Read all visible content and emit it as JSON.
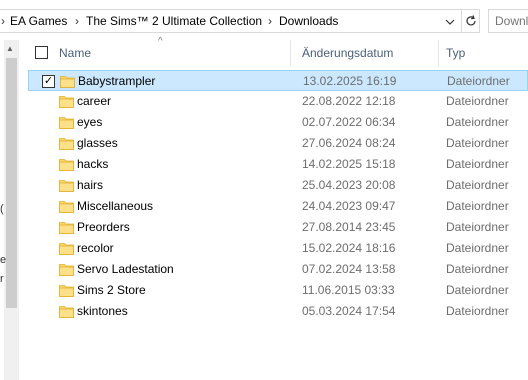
{
  "address": {
    "breadcrumbs": [
      "EA Games",
      "The Sims™ 2 Ultimate Collection",
      "Downloads"
    ],
    "separator": "›"
  },
  "search": {
    "placeholder": "Downloads durchsuchen"
  },
  "columns": {
    "name": "Name",
    "date": "Änderungsdatum",
    "type": "Typ"
  },
  "nav_fragments": [
    "(",
    "e",
    "r"
  ],
  "files": [
    {
      "name": "Babystrampler",
      "date": "13.02.2025 16:19",
      "type": "Dateiordner",
      "selected": true
    },
    {
      "name": "career",
      "date": "22.08.2022 12:18",
      "type": "Dateiordner",
      "selected": false
    },
    {
      "name": "eyes",
      "date": "02.07.2022 06:34",
      "type": "Dateiordner",
      "selected": false
    },
    {
      "name": "glasses",
      "date": "27.06.2024 08:24",
      "type": "Dateiordner",
      "selected": false
    },
    {
      "name": "hacks",
      "date": "14.02.2025 15:18",
      "type": "Dateiordner",
      "selected": false
    },
    {
      "name": "hairs",
      "date": "25.04.2023 20:08",
      "type": "Dateiordner",
      "selected": false
    },
    {
      "name": "Miscellaneous",
      "date": "24.04.2023 09:47",
      "type": "Dateiordner",
      "selected": false
    },
    {
      "name": "Preorders",
      "date": "27.08.2014 23:45",
      "type": "Dateiordner",
      "selected": false
    },
    {
      "name": "recolor",
      "date": "15.02.2024 18:16",
      "type": "Dateiordner",
      "selected": false
    },
    {
      "name": "Servo Ladestation",
      "date": "07.02.2024 13:58",
      "type": "Dateiordner",
      "selected": false
    },
    {
      "name": "Sims 2 Store",
      "date": "11.06.2015 03:33",
      "type": "Dateiordner",
      "selected": false
    },
    {
      "name": "skintones",
      "date": "05.03.2024 17:54",
      "type": "Dateiordner",
      "selected": false
    }
  ],
  "colors": {
    "selection": "#cce8ff",
    "selection_border": "#99d1ff",
    "folder": "#ffd766",
    "header_text": "#4c607a"
  },
  "icons": {
    "folder": "folder-icon",
    "refresh": "refresh-icon",
    "dropdown": "chevron-down-icon"
  }
}
